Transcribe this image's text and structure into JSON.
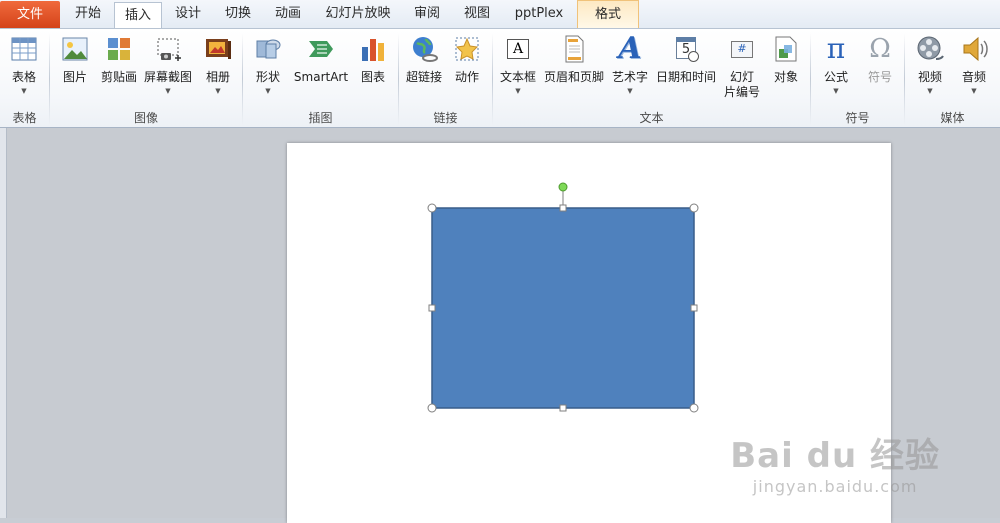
{
  "tabs": {
    "file": "文件",
    "items": [
      "开始",
      "插入",
      "设计",
      "切换",
      "动画",
      "幻灯片放映",
      "审阅",
      "视图",
      "pptPlex"
    ],
    "active": "插入",
    "context": "格式"
  },
  "groups": {
    "table": "表格",
    "images": "图像",
    "illustrations": "插图",
    "links": "链接",
    "text": "文本",
    "symbols": "符号",
    "media": "媒体"
  },
  "buttons": {
    "table": "表格",
    "picture": "图片",
    "clipart": "剪贴画",
    "screenshot": "屏幕截图",
    "album": "相册",
    "shapes": "形状",
    "smartart": "SmartArt",
    "chart": "图表",
    "hyperlink": "超链接",
    "action": "动作",
    "textbox": "文本框",
    "header_footer": "页眉和页脚",
    "wordart": "艺术字",
    "datetime": "日期和时间",
    "slide_number": "幻灯\n片编号",
    "object": "对象",
    "equation": "公式",
    "symbol": "符号",
    "video": "视频",
    "audio": "音频"
  },
  "icons": {
    "calendar_day": "5",
    "equation_glyph": "π",
    "symbol_glyph": "Ω",
    "textbox_glyph": "A",
    "wordart_glyph": "A",
    "slide_number_glyph": "#"
  },
  "watermark": {
    "logo": "Bai du 经验",
    "url": "jingyan.baidu.com"
  },
  "colors": {
    "shape_fill": "#4f81bd",
    "shape_stroke": "#385d8a",
    "file_tab": "#e0531f",
    "rotation_handle": "#7ed957"
  }
}
